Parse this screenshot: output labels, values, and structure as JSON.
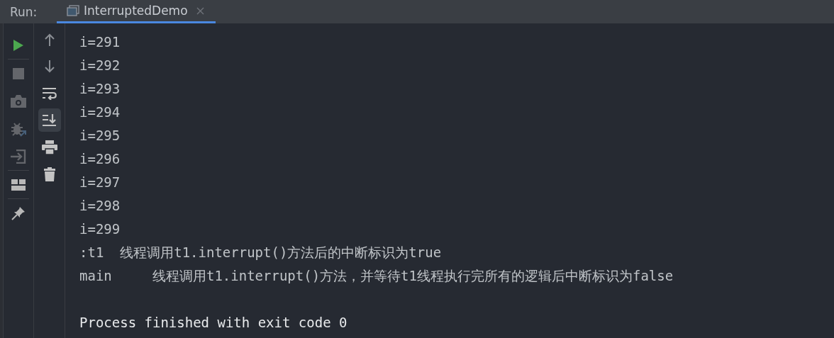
{
  "run_bar": {
    "label": "Run:",
    "tabs": [
      {
        "label": "InterruptedDemo",
        "selected": true
      }
    ]
  },
  "left_toolbar": [
    {
      "kind": "run",
      "enabled": true
    },
    {
      "kind": "divider"
    },
    {
      "kind": "stop",
      "enabled": false
    },
    {
      "kind": "camera",
      "enabled": false
    },
    {
      "kind": "bug",
      "enabled": false
    },
    {
      "kind": "enter",
      "enabled": false
    },
    {
      "kind": "divider"
    },
    {
      "kind": "layout",
      "enabled": true
    },
    {
      "kind": "divider"
    },
    {
      "kind": "pin",
      "enabled": true
    }
  ],
  "console_toolbar": [
    {
      "kind": "up",
      "selected": false
    },
    {
      "kind": "down",
      "selected": false
    },
    {
      "kind": "wrap",
      "selected": false
    },
    {
      "kind": "scroll-end",
      "selected": true
    },
    {
      "kind": "print",
      "selected": false
    },
    {
      "kind": "trash",
      "selected": false
    }
  ],
  "console_lines": [
    {
      "kind": "output",
      "text": "i=291"
    },
    {
      "kind": "output",
      "text": "i=292"
    },
    {
      "kind": "output",
      "text": "i=293"
    },
    {
      "kind": "output",
      "text": "i=294"
    },
    {
      "kind": "output",
      "text": "i=295"
    },
    {
      "kind": "output",
      "text": "i=296"
    },
    {
      "kind": "output",
      "text": "i=297"
    },
    {
      "kind": "output",
      "text": "i=298"
    },
    {
      "kind": "output",
      "text": "i=299"
    },
    {
      "kind": "output",
      "text": ":t1  线程调用t1.interrupt()方法后的中断标识为true"
    },
    {
      "kind": "output",
      "text": "main     线程调用t1.interrupt()方法，并等待t1线程执行完所有的逻辑后中断标识为false"
    },
    {
      "kind": "exit",
      "text": "Process finished with exit code 0"
    }
  ]
}
